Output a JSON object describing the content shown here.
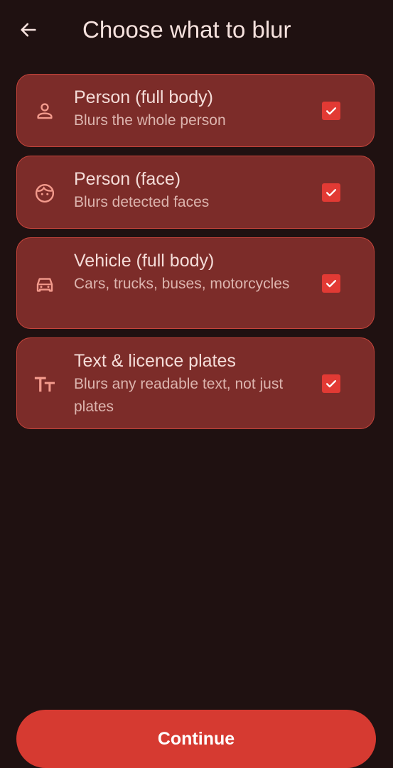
{
  "header": {
    "title": "Choose what to blur",
    "back_icon": "arrow-left-icon"
  },
  "options": [
    {
      "title": "Person (full body)",
      "subtitle": "Blurs the whole person",
      "icon": "person-icon",
      "checked": true
    },
    {
      "title": "Person (face)",
      "subtitle": "Blurs detected faces",
      "icon": "face-icon",
      "checked": true
    },
    {
      "title": "Vehicle (full body)",
      "subtitle": "Cars, trucks, buses, motorcycles",
      "icon": "car-icon",
      "checked": true
    },
    {
      "title": "Text & licence plates",
      "subtitle": "Blurs any readable text, not just plates",
      "icon": "text-fields-icon",
      "checked": true
    }
  ],
  "continue_label": "Continue",
  "colors": {
    "background": "#1f1111",
    "card": "#7c2c29",
    "card_border": "#c5443b",
    "accent": "#d63a31",
    "checkbox": "#e23a34",
    "icon": "#f39a8c"
  }
}
